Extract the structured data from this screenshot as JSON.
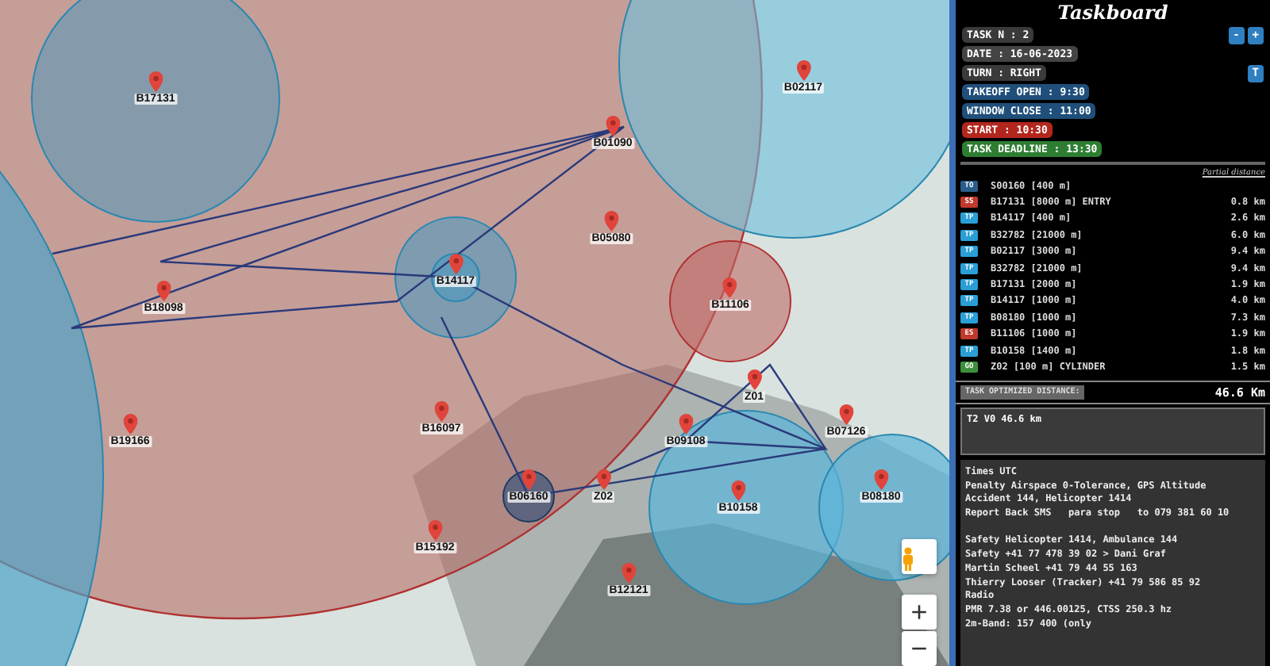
{
  "map": {
    "waypoints": [
      {
        "label": "B17131"
      },
      {
        "label": "B02117"
      },
      {
        "label": "B01090"
      },
      {
        "label": "B05080"
      },
      {
        "label": "B14117"
      },
      {
        "label": "B18098"
      },
      {
        "label": "B11106"
      },
      {
        "label": "Z01"
      },
      {
        "label": "B09108"
      },
      {
        "label": "B07126"
      },
      {
        "label": "B19166"
      },
      {
        "label": "B16097"
      },
      {
        "label": "B06160"
      },
      {
        "label": "Z02"
      },
      {
        "label": "B10158"
      },
      {
        "label": "B08180"
      },
      {
        "label": "B15192"
      },
      {
        "label": "B12121"
      }
    ],
    "zoom_in": "+",
    "zoom_out": "−"
  },
  "taskboard": {
    "title": "Taskboard",
    "info": [
      {
        "text": "TASK N : 2",
        "color": "#3a3a3a"
      },
      {
        "text": "DATE : 16-06-2023",
        "color": "#444444"
      },
      {
        "text": "TURN : RIGHT",
        "color": "#3a3a3a"
      },
      {
        "text": "TAKEOFF OPEN : 9:30",
        "color": "#1f4f7a"
      },
      {
        "text": "WINDOW CLOSE : 11:00",
        "color": "#1f4f7a"
      },
      {
        "text": "START : 10:30",
        "color": "#b3261e"
      },
      {
        "text": "TASK DEADLINE : 13:30",
        "color": "#2e7d32"
      }
    ],
    "task_buttons": [
      "-",
      "+"
    ],
    "turn_button": "T",
    "partial_header": "Partial distance",
    "turnpoints": [
      {
        "type": "TO",
        "color": "#2a5d8a",
        "name": "S00160 [400 m]"
      },
      {
        "type": "SS",
        "color": "#c0392b",
        "name": "B17131 [8000 m] ENTRY",
        "distance": "0.8 km"
      },
      {
        "type": "TP",
        "color": "#2a9fd6",
        "name": "B14117 [400 m]",
        "distance": "2.6 km"
      },
      {
        "type": "TP",
        "color": "#2a9fd6",
        "name": "B32782 [21000 m]",
        "distance": "6.0 km"
      },
      {
        "type": "TP",
        "color": "#2a9fd6",
        "name": "B02117 [3000 m]",
        "distance": "9.4 km"
      },
      {
        "type": "TP",
        "color": "#2a9fd6",
        "name": "B32782 [21000 m]",
        "distance": "9.4 km"
      },
      {
        "type": "TP",
        "color": "#2a9fd6",
        "name": "B17131 [2000 m]",
        "distance": "1.9 km"
      },
      {
        "type": "TP",
        "color": "#2a9fd6",
        "name": "B14117 [1000 m]",
        "distance": "4.0 km"
      },
      {
        "type": "TP",
        "color": "#2a9fd6",
        "name": "B08180 [1000 m]",
        "distance": "7.3 km"
      },
      {
        "type": "ES",
        "color": "#c0392b",
        "name": "B11106 [1000 m]",
        "distance": "1.9 km"
      },
      {
        "type": "TP",
        "color": "#2a9fd6",
        "name": "B10158 [1400 m]",
        "distance": "1.8 km"
      },
      {
        "type": "GO",
        "color": "#3c8f3c",
        "name": "Z02 [100 m] CYLINDER",
        "distance": "1.5 km"
      }
    ],
    "optimized_label": "TASK OPTIMIZED DISTANCE:",
    "optimized_value": "46.6 Km",
    "summary": "T2 V0 46.6 km",
    "notes": [
      [
        "Times UTC",
        "Penalty Airspace 0-Tolerance, GPS Altitude",
        "Accident 144, Helicopter 1414",
        "Report Back SMS   para stop   to 079 381 60 10"
      ],
      [
        "Safety Helicopter 1414, Ambulance 144",
        "Safety +41 77 478 39 02 > Dani Graf",
        "Martin Scheel +41 79 44 55 163",
        "Thierry Looser (Tracker) +41 79 586 85 92",
        "Radio",
        "PMR 7.38 or 446.00125, CTSS 250.3 hz",
        "2m-Band: 157 400 (only"
      ]
    ]
  }
}
